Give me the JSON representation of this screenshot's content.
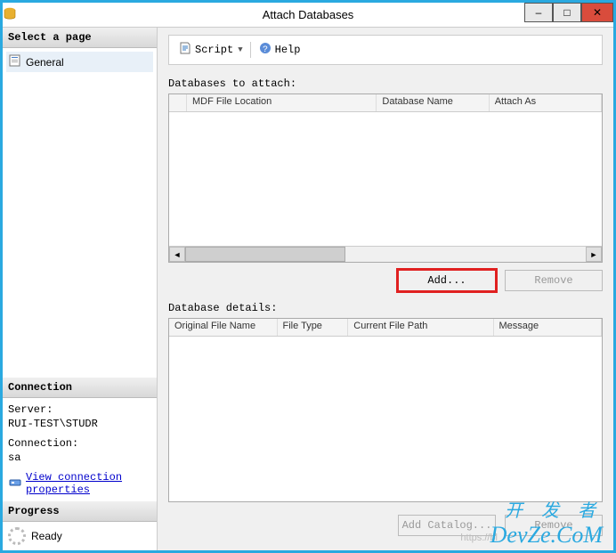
{
  "window": {
    "title": "Attach Databases",
    "minimize_symbol": "–",
    "maximize_symbol": "□",
    "close_symbol": "✕"
  },
  "left": {
    "select_page_header": "Select a page",
    "general_item": "General",
    "connection_header": "Connection",
    "server_label": "Server:",
    "server_value": "RUI-TEST\\STUDR",
    "conn_label": "Connection:",
    "conn_value": "sa",
    "view_conn_link": "View connection properties",
    "progress_header": "Progress",
    "progress_label": "Ready"
  },
  "toolbar": {
    "script_label": "Script",
    "help_label": "Help"
  },
  "main": {
    "databases_to_attach_label": "Databases to attach:",
    "attach_columns": {
      "mdf": "MDF File Location",
      "dbname": "Database Name",
      "attachas": "Attach As"
    },
    "add_button": "Add...",
    "remove_button_1": "Remove",
    "database_details_label": "Database details:",
    "details_columns": {
      "orig": "Original File Name",
      "ftype": "File Type",
      "curpath": "Current File Path",
      "message": "Message"
    },
    "add_catalog_button": "Add Catalog...",
    "remove_button_2": "Remove"
  },
  "watermark": {
    "cn": "开 发 者",
    "en": "DevZe.CoM"
  },
  "url_hint": "https://bl"
}
